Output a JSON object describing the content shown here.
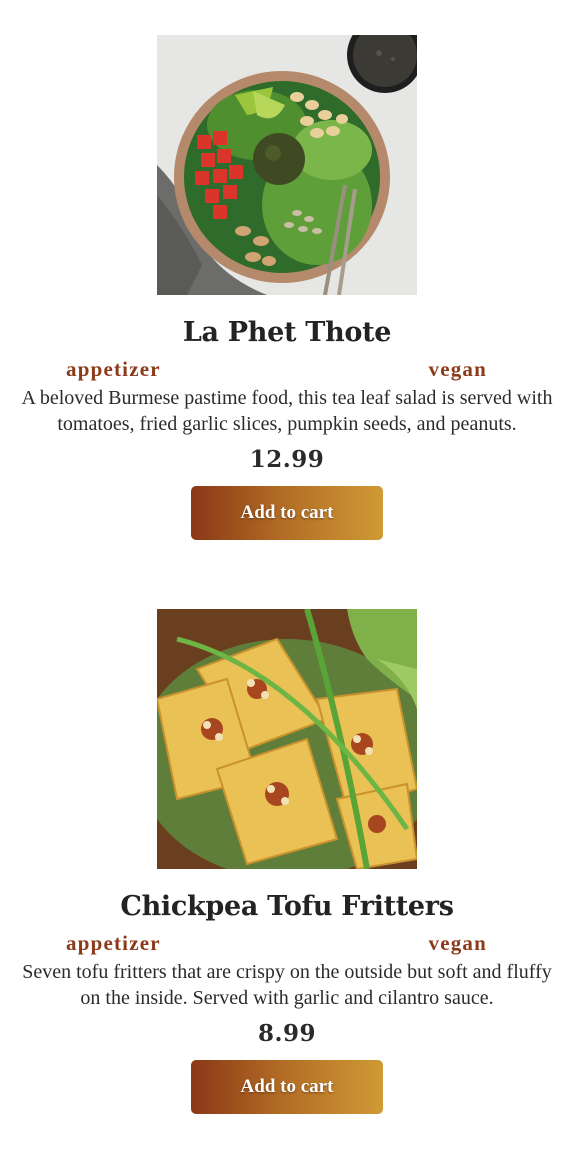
{
  "colors": {
    "tag": "#8b3a1a",
    "button_gradient_start": "#8a3816",
    "button_gradient_end": "#d09a35",
    "title": "#232323"
  },
  "items": [
    {
      "image": "tea-leaf-salad-photo",
      "name": "La Phet Thote",
      "course": "appetizer",
      "diet": "vegan",
      "description": "A beloved Burmese pastime food, this tea leaf salad is served with tomatoes, fried garlic slices, pumpkin seeds, and peanuts.",
      "price": "12.99",
      "button_label": "Add to cart"
    },
    {
      "image": "tofu-fritters-photo",
      "name": "Chickpea Tofu Fritters",
      "course": "appetizer",
      "diet": "vegan",
      "description": "Seven tofu fritters that are crispy on the outside but soft and fluffy on the inside. Served with garlic and cilantro sauce.",
      "price": "8.99",
      "button_label": "Add to cart"
    }
  ]
}
